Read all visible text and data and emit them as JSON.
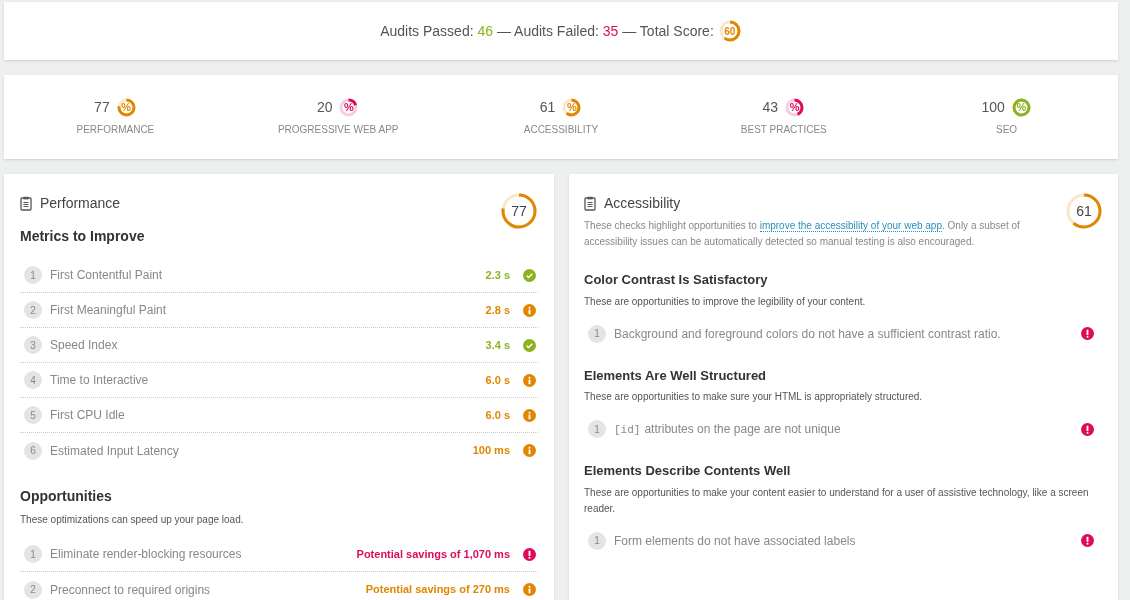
{
  "summary": {
    "passed_label": "Audits Passed:",
    "passed": "46",
    "failed_label": "— Audits Failed:",
    "failed": "35",
    "total_label": "— Total Score:",
    "total": "60",
    "kind": "average"
  },
  "categories": [
    {
      "score": "77",
      "symbol": "%",
      "label": "PERFORMANCE",
      "kind": "average"
    },
    {
      "score": "20",
      "symbol": "%",
      "label": "PROGRESSIVE WEB APP",
      "kind": "fail"
    },
    {
      "score": "61",
      "symbol": "%",
      "label": "ACCESSIBILITY",
      "kind": "average"
    },
    {
      "score": "43",
      "symbol": "%",
      "label": "BEST PRACTICES",
      "kind": "fail"
    },
    {
      "score": "100",
      "symbol": "%",
      "label": "SEO",
      "kind": "pass"
    }
  ],
  "performance": {
    "title": "Performance",
    "score": "77",
    "kind": "average",
    "metrics_title": "Metrics to Improve",
    "metrics": [
      {
        "index": "1",
        "name": "First Contentful Paint",
        "value": "2.3 s",
        "kind": "pass"
      },
      {
        "index": "2",
        "name": "First Meaningful Paint",
        "value": "2.8 s",
        "kind": "average"
      },
      {
        "index": "3",
        "name": "Speed Index",
        "value": "3.4 s",
        "kind": "pass"
      },
      {
        "index": "4",
        "name": "Time to Interactive",
        "value": "6.0 s",
        "kind": "average"
      },
      {
        "index": "5",
        "name": "First CPU Idle",
        "value": "6.0 s",
        "kind": "average"
      },
      {
        "index": "6",
        "name": "Estimated Input Latency",
        "value": "100 ms",
        "kind": "average"
      }
    ],
    "opportunities_title": "Opportunities",
    "opportunities_desc": "These optimizations can speed up your page load.",
    "opportunities": [
      {
        "index": "1",
        "name": "Eliminate render-blocking resources",
        "value": "Potential savings of 1,070 ms",
        "kind": "fail"
      },
      {
        "index": "2",
        "name": "Preconnect to required origins",
        "value": "Potential savings of 270 ms",
        "kind": "average"
      }
    ]
  },
  "accessibility": {
    "title": "Accessibility",
    "score": "61",
    "kind": "average",
    "intro_before": "These checks highlight opportunities to",
    "link": "improve the accessibility of your web app",
    "intro_after": ". Only a subset of accessibility issues can be automatically detected so manual testing is also encouraged.",
    "groups": [
      {
        "title": "Color Contrast Is Satisfactory",
        "desc": "These are opportunities to improve the legibility of your content.",
        "items": [
          {
            "index": "1",
            "text": "Background and foreground colors do not have a sufficient contrast ratio.",
            "kind": "fail"
          }
        ]
      },
      {
        "title": "Elements Are Well Structured",
        "desc": "These are opportunities to make sure your HTML is appropriately structured.",
        "items": [
          {
            "index": "1",
            "code": "[id]",
            "text": "attributes on the page are not unique",
            "kind": "fail"
          }
        ]
      },
      {
        "title": "Elements Describe Contents Well",
        "desc": "These are opportunities to make your content easier to understand for a user of assistive technology, like a screen reader.",
        "items": [
          {
            "index": "1",
            "text": "Form elements do not have associated labels",
            "kind": "fail"
          }
        ]
      }
    ]
  }
}
